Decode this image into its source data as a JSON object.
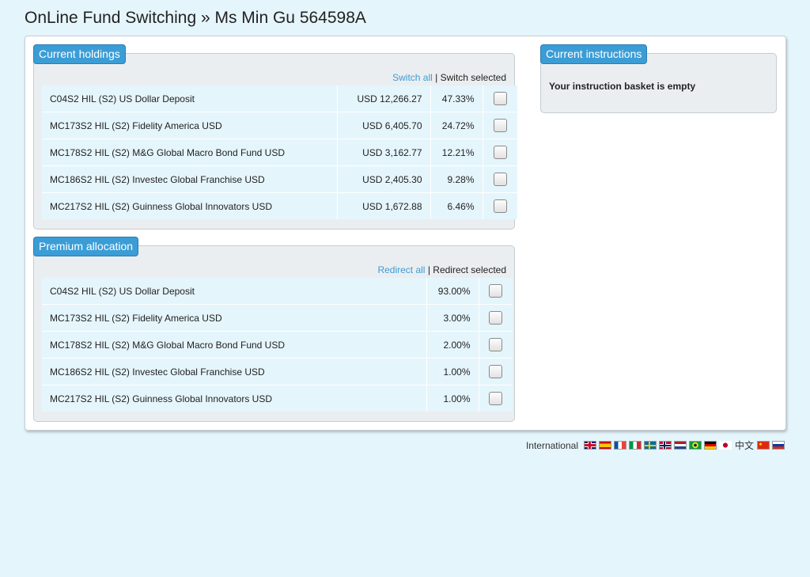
{
  "page": {
    "title": "OnLine Fund Switching » Ms Min Gu 564598A"
  },
  "holdings": {
    "legend": "Current holdings",
    "switch_all": "Switch all",
    "separator": "|",
    "switch_selected": "Switch selected",
    "rows": [
      {
        "fund": "C04S2 HIL (S2) US Dollar Deposit",
        "value": "USD 12,266.27",
        "pct": "47.33%"
      },
      {
        "fund": "MC173S2 HIL (S2) Fidelity America USD",
        "value": "USD 6,405.70",
        "pct": "24.72%"
      },
      {
        "fund": "MC178S2 HIL (S2) M&G Global Macro Bond Fund USD",
        "value": "USD 3,162.77",
        "pct": "12.21%"
      },
      {
        "fund": "MC186S2 HIL (S2) Investec Global Franchise USD",
        "value": "USD 2,405.30",
        "pct": "9.28%"
      },
      {
        "fund": "MC217S2 HIL (S2) Guinness Global Innovators USD",
        "value": "USD 1,672.88",
        "pct": "6.46%"
      }
    ]
  },
  "premium": {
    "legend": "Premium allocation",
    "redirect_all": "Redirect all",
    "separator": "|",
    "redirect_selected": "Redirect selected",
    "rows": [
      {
        "fund": "C04S2 HIL (S2) US Dollar Deposit",
        "pct": "93.00%"
      },
      {
        "fund": "MC173S2 HIL (S2) Fidelity America USD",
        "pct": "3.00%"
      },
      {
        "fund": "MC178S2 HIL (S2) M&G Global Macro Bond Fund USD",
        "pct": "2.00%"
      },
      {
        "fund": "MC186S2 HIL (S2) Investec Global Franchise USD",
        "pct": "1.00%"
      },
      {
        "fund": "MC217S2 HIL (S2) Guinness Global Innovators USD",
        "pct": "1.00%"
      }
    ]
  },
  "instructions": {
    "legend": "Current instructions",
    "empty_message": "Your instruction basket is empty"
  },
  "footer": {
    "label": "International",
    "chinese_text": "中文",
    "languages": [
      "uk-flag",
      "spain-flag",
      "france-flag",
      "italy-flag",
      "sweden-flag",
      "norway-flag",
      "netherlands-flag",
      "brazil-flag",
      "germany-flag",
      "japan-flag",
      "chinese-text",
      "china-flag",
      "russia-flag"
    ]
  },
  "colors": {
    "background": "#e5f5fc",
    "legend_bg": "#3b9dd6",
    "link": "#3b9dd6"
  }
}
